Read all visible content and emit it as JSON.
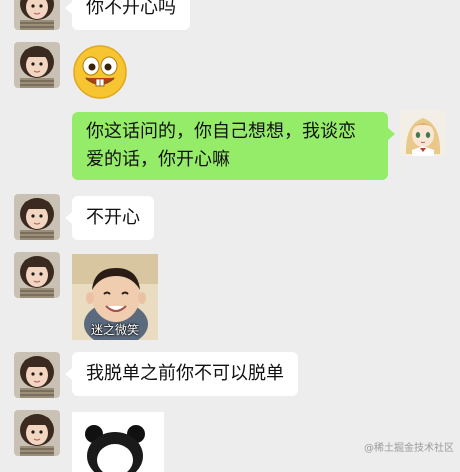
{
  "chat": {
    "messages": [
      {
        "side": "left",
        "type": "text",
        "text": "你不开心吗"
      },
      {
        "side": "left",
        "type": "emoji",
        "emoji": "grinning-buck-teeth-emoji"
      },
      {
        "side": "right",
        "type": "text",
        "line1": "你这话问的，你自己想想，我谈恋",
        "line2": "爱的话，你开心嘛"
      },
      {
        "side": "left",
        "type": "text",
        "text": "不开心"
      },
      {
        "side": "left",
        "type": "image",
        "caption": "迷之微笑"
      },
      {
        "side": "left",
        "type": "text",
        "text": "我脱单之前你不可以脱单"
      },
      {
        "side": "left",
        "type": "image",
        "image": "panda-meme-sticker"
      }
    ]
  },
  "watermark": "@稀土掘金技术社区",
  "colors": {
    "background": "#ededed",
    "bubble_incoming": "#ffffff",
    "bubble_outgoing": "#95ec69"
  }
}
